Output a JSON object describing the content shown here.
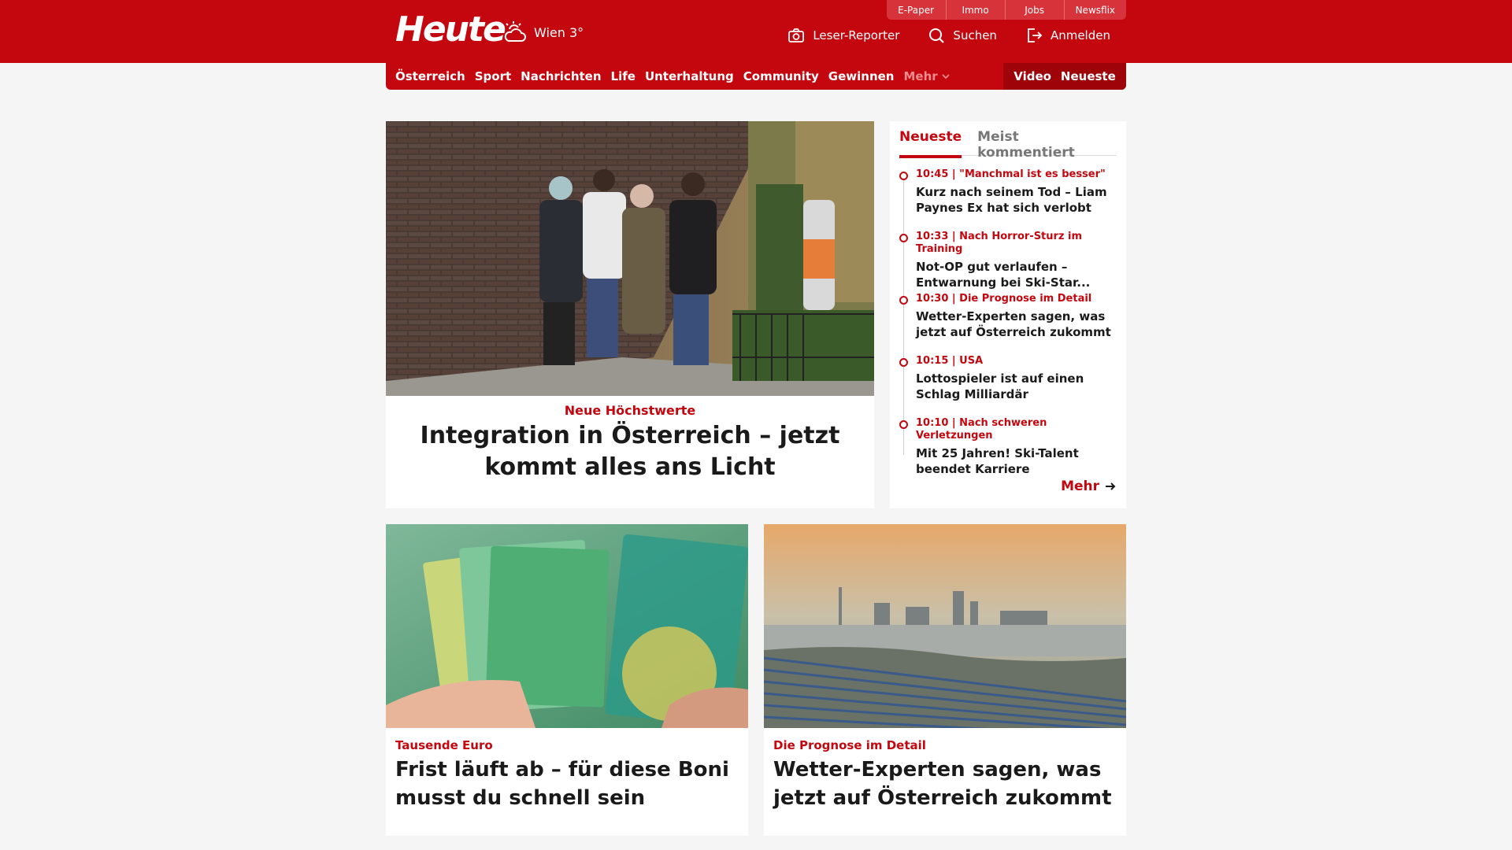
{
  "header": {
    "logo": "Heute",
    "weather": "Wien 3°",
    "top_links": [
      "E-Paper",
      "Immo",
      "Jobs",
      "Newsflix"
    ],
    "reporter_label": "Leser-Reporter",
    "search_label": "Suchen",
    "login_label": "Anmelden"
  },
  "nav": {
    "items": [
      "Österreich",
      "Sport",
      "Nachrichten",
      "Life",
      "Unterhaltung",
      "Community",
      "Gewinnen"
    ],
    "more": "Mehr",
    "video": "Video",
    "neueste": "Neueste"
  },
  "hero": {
    "kicker": "Neue Höchstwerte",
    "title": "Integration in Österreich – jetzt kommt alles ans Licht"
  },
  "sidebar": {
    "tabs": [
      "Neueste",
      "Meist kommentiert"
    ],
    "items": [
      {
        "meta": "10:45 | \"Manchmal ist es besser\"",
        "title": "Kurz nach seinem Tod – Liam Paynes Ex hat sich verlobt"
      },
      {
        "meta": "10:33 | Nach Horror-Sturz im Training",
        "title": "Not-OP gut verlaufen – Entwarnung bei Ski-Star..."
      },
      {
        "meta": "10:30 | Die Prognose im Detail",
        "title": "Wetter-Experten sagen, was jetzt auf Österreich zukommt"
      },
      {
        "meta": "10:15 | USA",
        "title": "Lottospieler ist auf einen Schlag Milliardär"
      },
      {
        "meta": "10:10 | Nach schweren Verletzungen",
        "title": "Mit 25 Jahren! Ski-Talent beendet Karriere"
      }
    ],
    "more_label": "Mehr"
  },
  "cards": [
    {
      "kicker": "Tausende Euro",
      "title": "Frist läuft ab – für diese Boni musst du schnell sein"
    },
    {
      "kicker": "Die Prognose im Detail",
      "title": "Wetter-Experten sagen, was jetzt auf Österreich zukommt"
    }
  ],
  "colors": {
    "brand": "#c4070f",
    "brand_dark": "#9d0309",
    "background": "#f5f5f5"
  }
}
